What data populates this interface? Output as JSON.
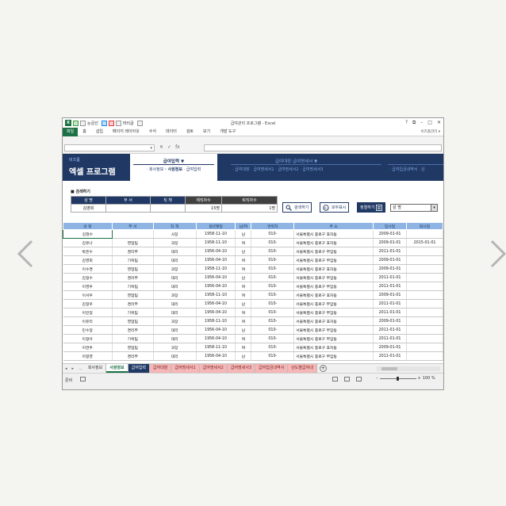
{
  "window": {
    "title": "급여관리 프로그램 - Excel",
    "controls": [
      "?",
      "⧉",
      "–",
      "□",
      "✕"
    ],
    "user": "비즈폼관리 ▾",
    "quick_access": [
      "눈금선",
      "머리글"
    ]
  },
  "ribbon_tabs": [
    "파일",
    "홈",
    "삽입",
    "페이지 레이아웃",
    "수식",
    "데이터",
    "검토",
    "보기",
    "개발 도구"
  ],
  "formula_bar": {
    "name_box": "",
    "formula": "",
    "fx": "fx"
  },
  "header": {
    "brand_small": "비즈폼",
    "brand_big": "엑셀 프로그램",
    "menu1": {
      "title": "급여입력 ▼",
      "items": [
        "· 회사정보",
        "· 사원정보",
        "· 급여입력"
      ]
    },
    "menu2": {
      "title": "급여대장·급여명세서 ▼",
      "items": [
        "· 급여대장",
        "· 급여명세서1",
        "· 급여명세서2",
        "· 급여명세서3"
      ]
    },
    "menu3": {
      "items": [
        "· 급여입금내역서",
        "· 년"
      ]
    }
  },
  "search": {
    "section_title": "■ 검색하기",
    "headers": [
      "성 명",
      "부 서",
      "직 책",
      "재직자수",
      "퇴직자수"
    ],
    "values": [
      "김영희",
      "",
      "",
      "15명",
      "1명"
    ],
    "buttons": {
      "search": "검색하기",
      "show_all": "모두표시",
      "sort": "정렬하기"
    },
    "sort_value": "성 명"
  },
  "grid": {
    "columns": [
      "성 명",
      "부 서",
      "직 책",
      "생년월일",
      "남/여",
      "연락처",
      "주 소",
      "입사일",
      "퇴사일"
    ],
    "rows": [
      [
        "김철수",
        "",
        "사장",
        "1958-11-10",
        "남",
        "010-",
        "서울특별시 종로구 효자동",
        "2009-01-01",
        ""
      ],
      [
        "김유나",
        "영업팀",
        "과장",
        "1958-11-10",
        "여",
        "010-",
        "서울특별시 종로구 효자동",
        "2009-01-01",
        "2015-01-01"
      ],
      [
        "박은수",
        "경리부",
        "대리",
        "1956-04-10",
        "남",
        "010-",
        "서울특별시 종로구 부암동",
        "2011-01-01",
        ""
      ],
      [
        "김영희",
        "기획팀",
        "대리",
        "1956-04-10",
        "여",
        "010-",
        "서울특별시 종로구 부암동",
        "2009-01-01",
        ""
      ],
      [
        "이수경",
        "영업팀",
        "과장",
        "1958-11-10",
        "여",
        "010-",
        "서울특별시 종로구 효자동",
        "2009-01-01",
        ""
      ],
      [
        "김정수",
        "경리부",
        "대리",
        "1956-04-10",
        "남",
        "010-",
        "서울특별시 종로구 부암동",
        "2011-01-01",
        ""
      ],
      [
        "이영우",
        "기획팀",
        "대리",
        "1956-04-10",
        "여",
        "010-",
        "서울특별시 종로구 부암동",
        "2011-01-01",
        ""
      ],
      [
        "이서우",
        "영업팀",
        "과장",
        "1958-11-10",
        "여",
        "010-",
        "서울특별시 종로구 효자동",
        "2009-01-01",
        ""
      ],
      [
        "김정우",
        "경리부",
        "대리",
        "1956-04-10",
        "남",
        "010-",
        "서울특별시 종로구 부암동",
        "2011-01-01",
        ""
      ],
      [
        "이민정",
        "기획팀",
        "대리",
        "1956-04-10",
        "여",
        "010-",
        "서울특별시 종로구 부암동",
        "2011-01-01",
        ""
      ],
      [
        "이유리",
        "영업팀",
        "과장",
        "1958-11-10",
        "여",
        "010-",
        "서울특별시 종로구 효자동",
        "2009-01-01",
        ""
      ],
      [
        "민수정",
        "경리부",
        "대리",
        "1956-04-10",
        "남",
        "010-",
        "서울특별시 종로구 부암동",
        "2011-01-01",
        ""
      ],
      [
        "이정아",
        "기획팀",
        "대리",
        "1956-04-10",
        "여",
        "010-",
        "서울특별시 종로구 부암동",
        "2011-01-01",
        ""
      ],
      [
        "이연주",
        "영업팀",
        "과장",
        "1958-11-10",
        "여",
        "010-",
        "서울특별시 종로구 효자동",
        "2009-01-01",
        ""
      ],
      [
        "어정영",
        "경리부",
        "대리",
        "1956-04-10",
        "남",
        "010-",
        "서울특별시 종로구 부암동",
        "2011-01-01",
        ""
      ]
    ]
  },
  "sheet_tabs": [
    {
      "label": "회사정보",
      "style": "normal"
    },
    {
      "label": "사원정보",
      "style": "cur"
    },
    {
      "label": "급여입력",
      "style": "blue"
    },
    {
      "label": "급여대장",
      "style": "pink"
    },
    {
      "label": "급여명세서1",
      "style": "pink"
    },
    {
      "label": "급여명세서2",
      "style": "pink"
    },
    {
      "label": "급여명세서3",
      "style": "pink"
    },
    {
      "label": "급여입금내역서",
      "style": "pink"
    },
    {
      "label": "년도별급여내",
      "style": "pink"
    }
  ],
  "tab_nav": [
    "◂",
    "▸",
    "..."
  ],
  "status": {
    "ready": "준비",
    "zoom": "100 %"
  },
  "colors": {
    "excel_green": "#1e7145",
    "navy": "#1f3864",
    "grid_header": "#8db4e2",
    "pink_tab": "#f4b6b6"
  }
}
